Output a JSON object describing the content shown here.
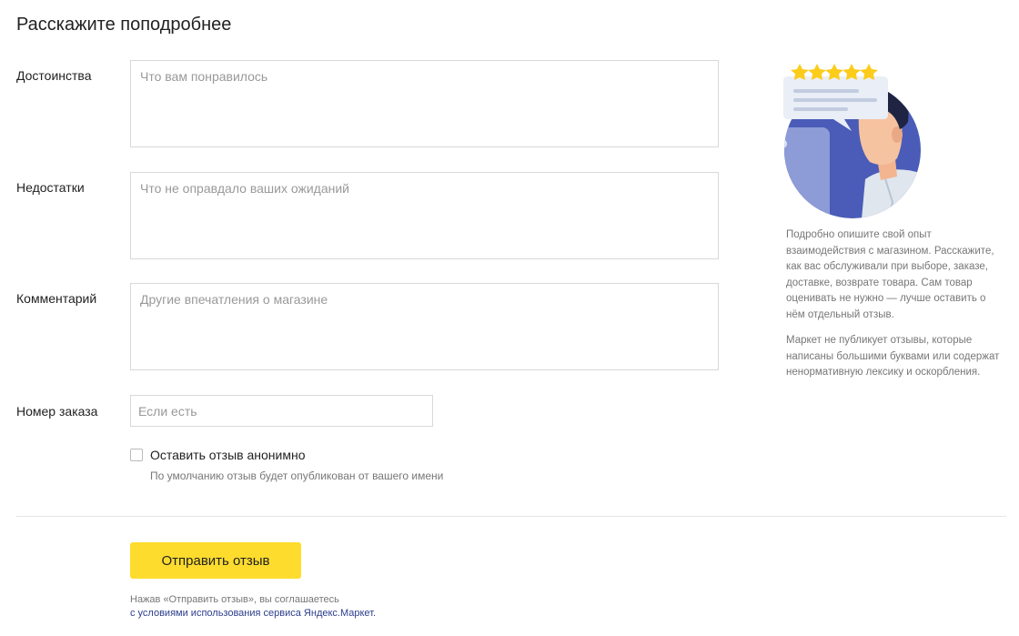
{
  "form": {
    "title": "Расскажите поподробнее",
    "pros": {
      "label": "Достоинства",
      "placeholder": "Что вам понравилось",
      "value": ""
    },
    "cons": {
      "label": "Недостатки",
      "placeholder": "Что не оправдало ваших ожиданий",
      "value": ""
    },
    "comment": {
      "label": "Комментарий",
      "placeholder": "Другие впечатления о магазине",
      "value": ""
    },
    "order": {
      "label": "Номер заказа",
      "placeholder": "Если есть",
      "value": ""
    },
    "anonymous": {
      "label": "Оставить отзыв анонимно",
      "hint": "По умолчанию отзыв будет опубликован от вашего имени",
      "checked": false
    },
    "submit_label": "Отправить отзыв",
    "terms_prefix": "Нажав «Отправить отзыв», вы соглашаетесь",
    "terms_link": "с условиями использования сервиса Яндекс.Маркет."
  },
  "sidebar": {
    "paragraph1": "Подробно опишите свой опыт взаимодействия с магазином. Расскажите, как вас обслуживали при выборе, заказе, доставке, возврате товара. Сам товар оценивать не нужно — лучше оставить о нём отдельный отзыв.",
    "paragraph2": "Маркет не публикует отзывы, которые написаны большими буквами или содержат ненормативную лексику и оскорбления.",
    "illustration": "reviewer-with-rating-illustration"
  },
  "colors": {
    "accent": "#fddc2e",
    "circle": "#4a5cb8",
    "link": "#2c3e8c",
    "star": "#fccc1b"
  }
}
